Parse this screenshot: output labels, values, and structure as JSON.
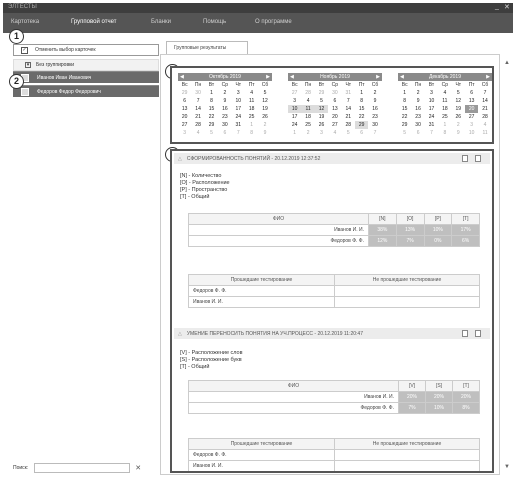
{
  "window": {
    "title": "ЭЛТЕСТЫ",
    "controls": [
      "_",
      "✕"
    ]
  },
  "menu": [
    "Картотека",
    "Групповой отчет",
    "Бланки",
    "Помощь",
    "О программе"
  ],
  "sidebar": {
    "cancel_label": "Отменить выбор карточек",
    "group_label": "Без группировки",
    "cards": [
      "Иванов Иван Иванович",
      "Федоров Федор Федорович"
    ],
    "search_label": "Поиск:",
    "search_value": ""
  },
  "tab_label": "Групповые результаты",
  "badges": [
    "1",
    "2",
    "3",
    "4"
  ],
  "calendars": [
    {
      "title": "Октябрь 2019",
      "dow": [
        "Вс",
        "Пн",
        "Вт",
        "Ср",
        "Чт",
        "Пт",
        "Сб"
      ],
      "days": [
        "29",
        "30",
        "1",
        "2",
        "3",
        "4",
        "5",
        "6",
        "7",
        "8",
        "9",
        "10",
        "11",
        "12",
        "13",
        "14",
        "15",
        "16",
        "17",
        "18",
        "19",
        "20",
        "21",
        "22",
        "23",
        "24",
        "25",
        "26",
        "27",
        "28",
        "29",
        "30",
        "31",
        "1",
        "2",
        "3",
        "4",
        "5",
        "6",
        "7",
        "8",
        "9"
      ]
    },
    {
      "title": "Ноябрь 2019",
      "dow": [
        "Вс",
        "Пн",
        "Вт",
        "Ср",
        "Чт",
        "Пт",
        "Сб"
      ],
      "days": [
        "27",
        "28",
        "29",
        "30",
        "31",
        "1",
        "2",
        "3",
        "4",
        "5",
        "6",
        "7",
        "8",
        "9",
        "10",
        "11",
        "12",
        "13",
        "14",
        "15",
        "16",
        "17",
        "18",
        "19",
        "20",
        "21",
        "22",
        "23",
        "24",
        "25",
        "26",
        "27",
        "28",
        "29",
        "30",
        "1",
        "2",
        "3",
        "4",
        "5",
        "6",
        "7"
      ]
    },
    {
      "title": "Декабрь 2019",
      "dow": [
        "Вс",
        "Пн",
        "Вт",
        "Ср",
        "Чт",
        "Пт",
        "Сб"
      ],
      "days": [
        "1",
        "2",
        "3",
        "4",
        "5",
        "6",
        "7",
        "8",
        "9",
        "10",
        "11",
        "12",
        "13",
        "14",
        "15",
        "16",
        "17",
        "18",
        "19",
        "20",
        "21",
        "22",
        "23",
        "24",
        "25",
        "26",
        "27",
        "28",
        "29",
        "30",
        "31",
        "1",
        "2",
        "3",
        "4",
        "5",
        "6",
        "7",
        "8",
        "9",
        "10",
        "11"
      ]
    }
  ],
  "sections": [
    {
      "title": "СФОРМИРОВАННОСТЬ ПОНЯТИЙ - 20.12.2019  12:37:52",
      "legend": [
        "[N] - Количество",
        "[O] - Расположение",
        "[P] - Пространство",
        "[T] - Общий"
      ],
      "columns": [
        "ФИО",
        "[N]",
        "[O]",
        "[P]",
        "[T]"
      ],
      "rows": [
        {
          "name": "Иванов И. И.",
          "values": [
            "38%",
            "13%",
            "10%",
            "17%"
          ]
        },
        {
          "name": "Федоров Ф. Ф.",
          "values": [
            "12%",
            "7%",
            "0%",
            "6%"
          ]
        }
      ],
      "pass_headers": [
        "Прошедшие тестирование",
        "Не прошедшие тестирование"
      ],
      "passed": [
        "Федоров Ф. Ф.",
        "Иванов И. И."
      ]
    },
    {
      "title": "УМЕНИЕ ПЕРЕНОСИТЬ ПОНЯТИЯ НА УЧ.ПРОЦЕСС - 20.12.2019  11:20:47",
      "legend": [
        "[V] - Расположение слов",
        "[S] - Расположение букв",
        "[T] - Общий"
      ],
      "columns": [
        "ФИО",
        "[V]",
        "[S]",
        "[T]"
      ],
      "rows": [
        {
          "name": "Иванов И. И.",
          "values": [
            "20%",
            "20%",
            "20%"
          ]
        },
        {
          "name": "Федоров Ф. Ф.",
          "values": [
            "7%",
            "10%",
            "8%"
          ]
        }
      ],
      "pass_headers": [
        "Прошедшие тестирование",
        "Не прошедшие тестирование"
      ],
      "passed": [
        "Федоров Ф. Ф.",
        "Иванов И. И."
      ]
    }
  ]
}
